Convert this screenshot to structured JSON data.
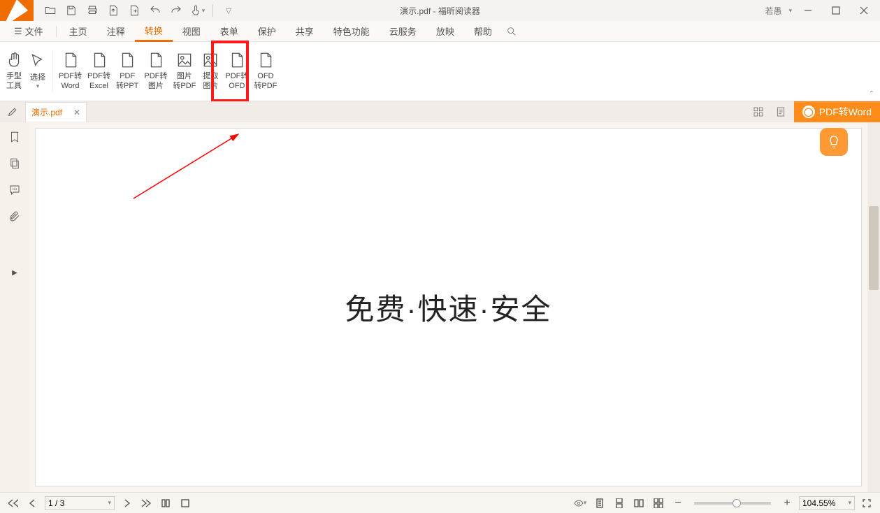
{
  "title": {
    "doc": "演示.pdf",
    "sep": " - ",
    "app": "福昕阅读器"
  },
  "user": {
    "name": "若愚"
  },
  "menu": {
    "file": "文件",
    "items": [
      "主页",
      "注释",
      "转换",
      "视图",
      "表单",
      "保护",
      "共享",
      "特色功能",
      "云服务",
      "放映",
      "帮助"
    ],
    "active_index": 2
  },
  "ribbon": {
    "tools": [
      {
        "l1": "手型",
        "l2": "工具",
        "icon": "hand"
      },
      {
        "l1": "选择",
        "l2": "",
        "icon": "select",
        "dropdown": true
      },
      {
        "l1": "PDF转",
        "l2": "Word",
        "icon": "doc"
      },
      {
        "l1": "PDF转",
        "l2": "Excel",
        "icon": "doc"
      },
      {
        "l1": "PDF",
        "l2": "转PPT",
        "icon": "doc"
      },
      {
        "l1": "PDF转",
        "l2": "图片",
        "icon": "doc"
      },
      {
        "l1": "图片",
        "l2": "转PDF",
        "icon": "img"
      },
      {
        "l1": "提取",
        "l2": "图片",
        "icon": "img"
      },
      {
        "l1": "PDF转",
        "l2": "OFD",
        "icon": "doc"
      },
      {
        "l1": "OFD",
        "l2": "转PDF",
        "icon": "doc"
      }
    ]
  },
  "doctab": {
    "name": "演示.pdf"
  },
  "badge": {
    "label": "PDF转Word"
  },
  "page_content": "免费·快速·安全",
  "status": {
    "page": "1 / 3",
    "zoom": "104.55%"
  }
}
